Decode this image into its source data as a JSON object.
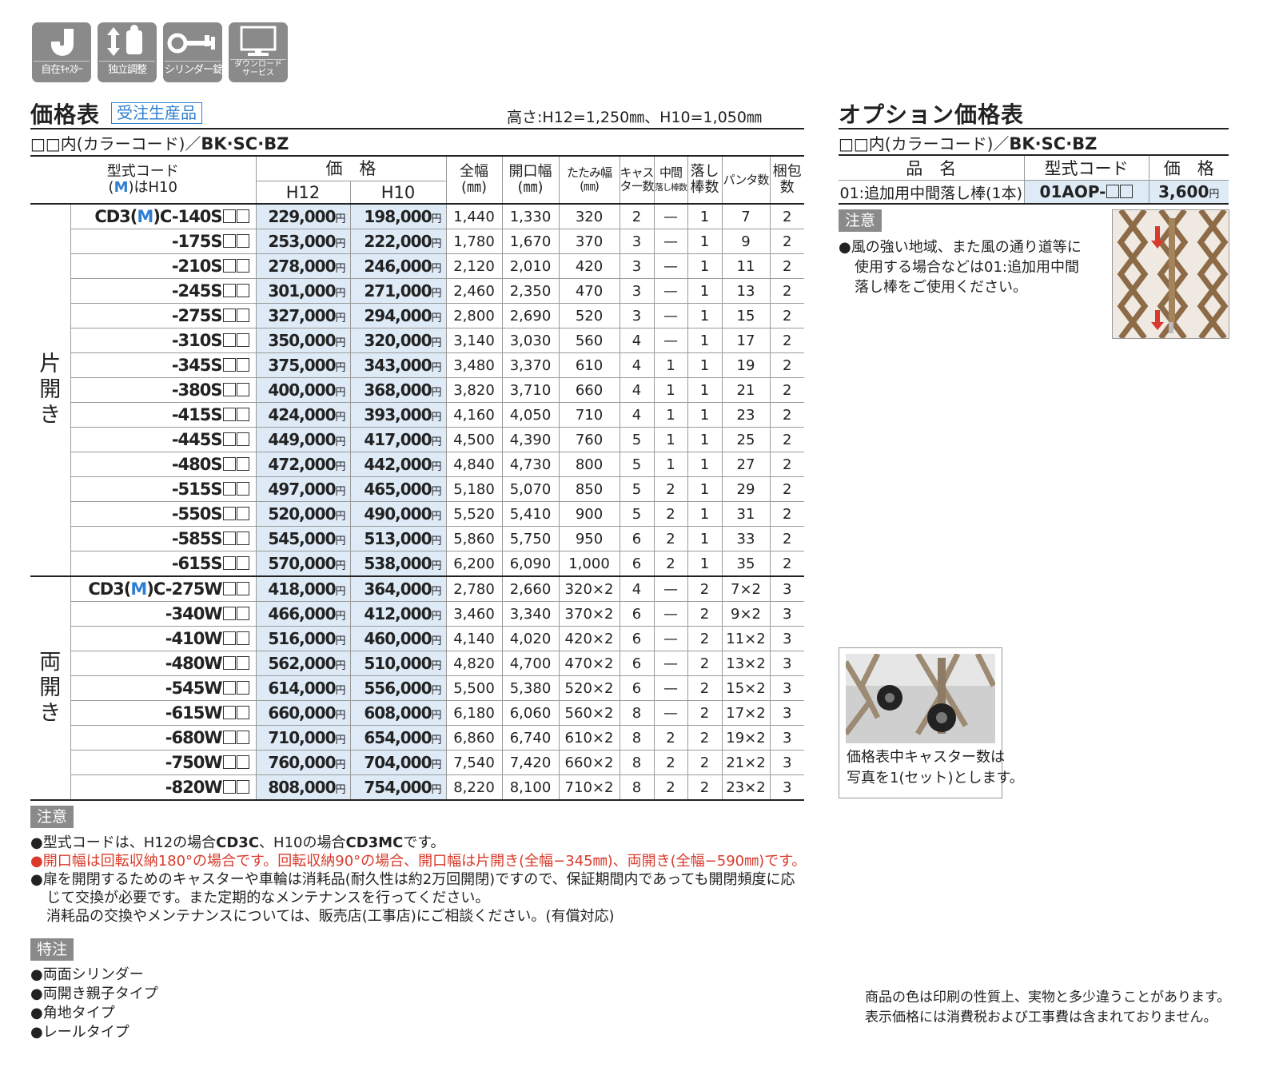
{
  "icons": [
    {
      "name": "caster-icon",
      "label": "自在ｷｬｽﾀｰ"
    },
    {
      "name": "adjust-icon",
      "label": "独立調整"
    },
    {
      "name": "key-icon",
      "label": "シリンダー錠"
    },
    {
      "name": "monitor-icon",
      "label_line1": "ダウンロード",
      "label_line2": "サービス"
    }
  ],
  "price_section": {
    "title": "価格表",
    "badge": "受注生産品",
    "height_note": "高さ:H12=1,250㎜、H10=1,050㎜",
    "color_code_prefix": "□□内(カラーコード)／",
    "color_code_value": "BK·SC·BZ"
  },
  "price_table": {
    "headers": {
      "model_line1": "型式コード",
      "model_m": "M",
      "model_paren_open": "(",
      "model_paren_close": ")はH10",
      "price": "価　格",
      "h12": "H12",
      "h10": "H10",
      "full_width_1": "全幅",
      "full_width_2": "(㎜)",
      "open_width_1": "開口幅",
      "open_width_2": "(㎜)",
      "folded_width_1": "たたみ幅",
      "folded_width_2": "(㎜)",
      "casters_1": "キャス",
      "casters_2": "ター数",
      "mid_rods_1": "中間",
      "mid_rods_2": "落し棒数",
      "rods_1": "落し",
      "rods_2": "棒数",
      "panta": "パンタ数",
      "packs_1": "梱包",
      "packs_2": "数"
    },
    "yen": "円",
    "groups": [
      {
        "label_chars": [
          "片",
          "開",
          "き"
        ],
        "rows": [
          {
            "prefix_a": "CD3(",
            "m": "M",
            "prefix_b": ")C",
            "code": "-140S",
            "h12": "229,000",
            "h10": "198,000",
            "full": "1,440",
            "open": "1,330",
            "fold": "320",
            "casters": "2",
            "mid": "—",
            "rods": "1",
            "panta": "7",
            "packs": "2"
          },
          {
            "code": "-175S",
            "h12": "253,000",
            "h10": "222,000",
            "full": "1,780",
            "open": "1,670",
            "fold": "370",
            "casters": "3",
            "mid": "—",
            "rods": "1",
            "panta": "9",
            "packs": "2"
          },
          {
            "code": "-210S",
            "h12": "278,000",
            "h10": "246,000",
            "full": "2,120",
            "open": "2,010",
            "fold": "420",
            "casters": "3",
            "mid": "—",
            "rods": "1",
            "panta": "11",
            "packs": "2"
          },
          {
            "code": "-245S",
            "h12": "301,000",
            "h10": "271,000",
            "full": "2,460",
            "open": "2,350",
            "fold": "470",
            "casters": "3",
            "mid": "—",
            "rods": "1",
            "panta": "13",
            "packs": "2"
          },
          {
            "code": "-275S",
            "h12": "327,000",
            "h10": "294,000",
            "full": "2,800",
            "open": "2,690",
            "fold": "520",
            "casters": "3",
            "mid": "—",
            "rods": "1",
            "panta": "15",
            "packs": "2"
          },
          {
            "code": "-310S",
            "h12": "350,000",
            "h10": "320,000",
            "full": "3,140",
            "open": "3,030",
            "fold": "560",
            "casters": "4",
            "mid": "—",
            "rods": "1",
            "panta": "17",
            "packs": "2"
          },
          {
            "code": "-345S",
            "h12": "375,000",
            "h10": "343,000",
            "full": "3,480",
            "open": "3,370",
            "fold": "610",
            "casters": "4",
            "mid": "1",
            "rods": "1",
            "panta": "19",
            "packs": "2"
          },
          {
            "code": "-380S",
            "h12": "400,000",
            "h10": "368,000",
            "full": "3,820",
            "open": "3,710",
            "fold": "660",
            "casters": "4",
            "mid": "1",
            "rods": "1",
            "panta": "21",
            "packs": "2"
          },
          {
            "code": "-415S",
            "h12": "424,000",
            "h10": "393,000",
            "full": "4,160",
            "open": "4,050",
            "fold": "710",
            "casters": "4",
            "mid": "1",
            "rods": "1",
            "panta": "23",
            "packs": "2"
          },
          {
            "code": "-445S",
            "h12": "449,000",
            "h10": "417,000",
            "full": "4,500",
            "open": "4,390",
            "fold": "760",
            "casters": "5",
            "mid": "1",
            "rods": "1",
            "panta": "25",
            "packs": "2"
          },
          {
            "code": "-480S",
            "h12": "472,000",
            "h10": "442,000",
            "full": "4,840",
            "open": "4,730",
            "fold": "800",
            "casters": "5",
            "mid": "1",
            "rods": "1",
            "panta": "27",
            "packs": "2"
          },
          {
            "code": "-515S",
            "h12": "497,000",
            "h10": "465,000",
            "full": "5,180",
            "open": "5,070",
            "fold": "850",
            "casters": "5",
            "mid": "2",
            "rods": "1",
            "panta": "29",
            "packs": "2"
          },
          {
            "code": "-550S",
            "h12": "520,000",
            "h10": "490,000",
            "full": "5,520",
            "open": "5,410",
            "fold": "900",
            "casters": "5",
            "mid": "2",
            "rods": "1",
            "panta": "31",
            "packs": "2"
          },
          {
            "code": "-585S",
            "h12": "545,000",
            "h10": "513,000",
            "full": "5,860",
            "open": "5,750",
            "fold": "950",
            "casters": "6",
            "mid": "2",
            "rods": "1",
            "panta": "33",
            "packs": "2"
          },
          {
            "code": "-615S",
            "h12": "570,000",
            "h10": "538,000",
            "full": "6,200",
            "open": "6,090",
            "fold": "1,000",
            "casters": "6",
            "mid": "2",
            "rods": "1",
            "panta": "35",
            "packs": "2"
          }
        ]
      },
      {
        "label_chars": [
          "両",
          "開",
          "き"
        ],
        "rows": [
          {
            "prefix_a": "CD3(",
            "m": "M",
            "prefix_b": ")C",
            "code": "-275W",
            "h12": "418,000",
            "h10": "364,000",
            "full": "2,780",
            "open": "2,660",
            "fold": "320×2",
            "casters": "4",
            "mid": "—",
            "rods": "2",
            "panta": "7×2",
            "packs": "3"
          },
          {
            "code": "-340W",
            "h12": "466,000",
            "h10": "412,000",
            "full": "3,460",
            "open": "3,340",
            "fold": "370×2",
            "casters": "6",
            "mid": "—",
            "rods": "2",
            "panta": "9×2",
            "packs": "3"
          },
          {
            "code": "-410W",
            "h12": "516,000",
            "h10": "460,000",
            "full": "4,140",
            "open": "4,020",
            "fold": "420×2",
            "casters": "6",
            "mid": "—",
            "rods": "2",
            "panta": "11×2",
            "packs": "3"
          },
          {
            "code": "-480W",
            "h12": "562,000",
            "h10": "510,000",
            "full": "4,820",
            "open": "4,700",
            "fold": "470×2",
            "casters": "6",
            "mid": "—",
            "rods": "2",
            "panta": "13×2",
            "packs": "3"
          },
          {
            "code": "-545W",
            "h12": "614,000",
            "h10": "556,000",
            "full": "5,500",
            "open": "5,380",
            "fold": "520×2",
            "casters": "6",
            "mid": "—",
            "rods": "2",
            "panta": "15×2",
            "packs": "3"
          },
          {
            "code": "-615W",
            "h12": "660,000",
            "h10": "608,000",
            "full": "6,180",
            "open": "6,060",
            "fold": "560×2",
            "casters": "8",
            "mid": "—",
            "rods": "2",
            "panta": "17×2",
            "packs": "3"
          },
          {
            "code": "-680W",
            "h12": "710,000",
            "h10": "654,000",
            "full": "6,860",
            "open": "6,740",
            "fold": "610×2",
            "casters": "8",
            "mid": "2",
            "rods": "2",
            "panta": "19×2",
            "packs": "3"
          },
          {
            "code": "-750W",
            "h12": "760,000",
            "h10": "704,000",
            "full": "7,540",
            "open": "7,420",
            "fold": "660×2",
            "casters": "8",
            "mid": "2",
            "rods": "2",
            "panta": "21×2",
            "packs": "3"
          },
          {
            "code": "-820W",
            "h12": "808,000",
            "h10": "754,000",
            "full": "8,220",
            "open": "8,100",
            "fold": "710×2",
            "casters": "8",
            "mid": "2",
            "rods": "2",
            "panta": "23×2",
            "packs": "3"
          }
        ]
      }
    ]
  },
  "notes": {
    "label": "注意",
    "line1_a": "●型式コードは、H12の場合",
    "line1_b": "CD3C",
    "line1_c": "、H10の場合",
    "line1_d": "CD3MC",
    "line1_e": "です。",
    "line2": "●開口幅は回転収納180°の場合です。回転収納90°の場合、開口幅は片開き(全幅−345㎜)、両開き(全幅−590㎜)です。",
    "line3": "●扉を開閉するためのキャスターや車輪は消耗品(耐久性は約2万回開閉)ですので、保証期間内であっても開閉頻度に応",
    "line4": "じて交換が必要です。また定期的なメンテナンスを行ってください。",
    "line5": "消耗品の交換やメンテナンスについては、販売店(工事店)にご相談ください。(有償対応)"
  },
  "special": {
    "label": "特注",
    "items": [
      "●両面シリンダー",
      "●両開き親子タイプ",
      "●角地タイプ",
      "●レールタイプ"
    ]
  },
  "option_section": {
    "title": "オプション価格表",
    "color_code_prefix": "□□内(カラーコード)／",
    "color_code_value": "BK·SC·BZ",
    "headers": {
      "name": "品　名",
      "code": "型式コード",
      "price": "価　格"
    },
    "row": {
      "name": "01:追加用中間落し棒(1本)",
      "code": "01AOP-",
      "price": "3,600",
      "yen": "円"
    },
    "note_label": "注意",
    "note_lines": [
      "●風の強い地域、また風の通り道等に",
      "使用する場合などは01:追加用中間",
      "落し棒をご使用ください。"
    ]
  },
  "caster_photo": {
    "caption_lines": [
      "価格表中キャスター数は",
      "写真を1(セット)とします。"
    ]
  },
  "disclaimer": [
    "商品の色は印刷の性質上、実物と多少違うことがあります。",
    "表示価格には消費税および工事費は含まれておりません。"
  ]
}
